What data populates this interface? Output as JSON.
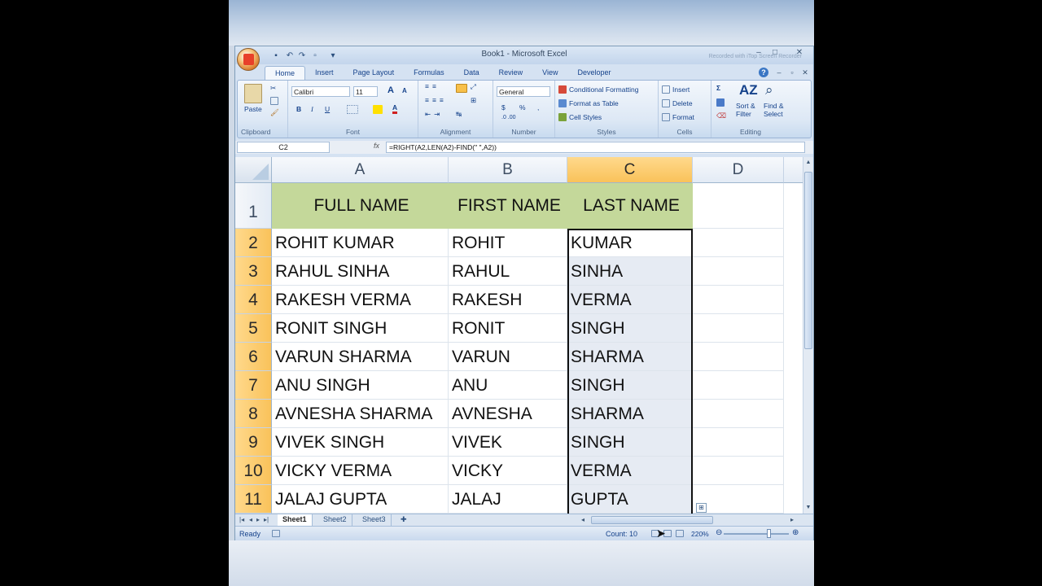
{
  "window": {
    "title": "Book1 - Microsoft Excel",
    "recorded": "Recorded with iTop Screen Recorder"
  },
  "tabs": [
    "Home",
    "Insert",
    "Page Layout",
    "Formulas",
    "Data",
    "Review",
    "View",
    "Developer"
  ],
  "ribbon": {
    "clipboard": {
      "paste": "Paste",
      "label": "Clipboard"
    },
    "font": {
      "name": "Calibri",
      "size": "11",
      "bold": "B",
      "italic": "I",
      "underline": "U",
      "grow": "A",
      "shrink": "A",
      "color": "A",
      "label": "Font"
    },
    "alignment": {
      "label": "Alignment"
    },
    "number": {
      "format": "General",
      "currency": "$",
      "percent": "%",
      "comma": ",",
      "label": "Number"
    },
    "styles": {
      "conditional": "Conditional Formatting",
      "format_table": "Format as Table",
      "cell_styles": "Cell Styles",
      "label": "Styles"
    },
    "cells": {
      "insert": "Insert",
      "delete": "Delete",
      "format": "Format",
      "label": "Cells"
    },
    "editing": {
      "sum": "Σ",
      "sort": "Sort &",
      "filter": "Filter",
      "find": "Find &",
      "select": "Select",
      "label": "Editing"
    }
  },
  "formula_bar": {
    "name_box": "C2",
    "fx": "fx",
    "formula": "=RIGHT(A2,LEN(A2)-FIND(\" \",A2))"
  },
  "columns": [
    "A",
    "B",
    "C",
    "D"
  ],
  "rows": [
    {
      "num": "1",
      "a": "FULL NAME",
      "b": "FIRST NAME",
      "c": "LAST NAME"
    },
    {
      "num": "2",
      "a": "ROHIT KUMAR",
      "b": "ROHIT",
      "c": "KUMAR"
    },
    {
      "num": "3",
      "a": "RAHUL SINHA",
      "b": "RAHUL",
      "c": "SINHA"
    },
    {
      "num": "4",
      "a": "RAKESH VERMA",
      "b": "RAKESH",
      "c": "VERMA"
    },
    {
      "num": "5",
      "a": "RONIT SINGH",
      "b": "RONIT",
      "c": "SINGH"
    },
    {
      "num": "6",
      "a": "VARUN SHARMA",
      "b": "VARUN",
      "c": "SHARMA"
    },
    {
      "num": "7",
      "a": "ANU SINGH",
      "b": "ANU",
      "c": "SINGH"
    },
    {
      "num": "8",
      "a": "AVNESHA SHARMA",
      "b": "AVNESHA",
      "c": "SHARMA"
    },
    {
      "num": "9",
      "a": "VIVEK SINGH",
      "b": "VIVEK",
      "c": "SINGH"
    },
    {
      "num": "10",
      "a": "VICKY VERMA",
      "b": "VICKY",
      "c": "VERMA"
    },
    {
      "num": "11",
      "a": "JALAJ GUPTA",
      "b": "JALAJ",
      "c": "GUPTA"
    }
  ],
  "sheets": [
    "Sheet1",
    "Sheet2",
    "Sheet3"
  ],
  "status": {
    "text": "Ready",
    "count": "Count: 10",
    "zoom": "220%"
  },
  "colors": {
    "header_fill": "#c4d89a",
    "selected_header": "#f9c25a",
    "ribbon_text": "#15428b"
  }
}
